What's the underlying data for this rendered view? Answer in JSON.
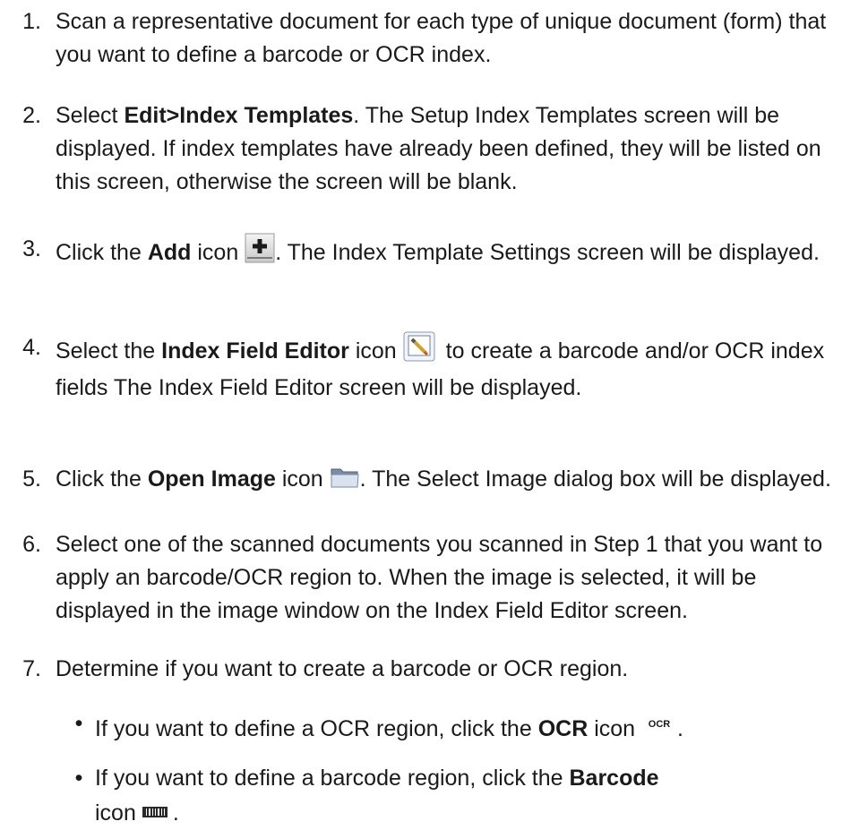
{
  "steps": [
    {
      "num": "1.",
      "text": "Scan a representative document for each type of unique document (form) that you want to define a barcode or OCR index."
    },
    {
      "num": "2.",
      "pre": "Select ",
      "bold": "Edit>Index Templates",
      "post": ". The Setup Index Templates screen will be displayed. If index templates have already been defined, they will be listed on this screen, otherwise the screen will be blank."
    },
    {
      "num": "3.",
      "pre": "Click the ",
      "bold": "Add",
      "mid": " icon ",
      "icon": "add-icon",
      "post": ". The Index Template Settings screen will be displayed."
    },
    {
      "num": "4.",
      "pre": "Select the ",
      "bold": "Index Field Editor",
      "mid": " icon ",
      "icon": "index-field-editor-icon",
      "post": "to create a barcode and/or OCR index fields The Index Field Editor screen will be displayed."
    },
    {
      "num": "5.",
      "pre": "Click the ",
      "bold": "Open Image",
      "mid": " icon ",
      "icon": "open-folder-icon",
      "post": ". The Select Image dialog box will be displayed."
    },
    {
      "num": "6.",
      "text": "Select one of the scanned documents you scanned in Step 1 that you want to apply an barcode/OCR region to. When the image is selected, it will be displayed in the image window on the Index Field Editor screen."
    },
    {
      "num": "7.",
      "text": "Determine if you want to create a barcode or OCR region."
    }
  ],
  "bullets": [
    {
      "dot": "•",
      "pre": "If you want to define a OCR region, click the ",
      "bold": "OCR",
      "mid": " icon ",
      "icon_text": "OCR",
      "post": "."
    },
    {
      "dot": "•",
      "pre": "If you want to define a barcode region, click the ",
      "bold": "Barcode",
      "line2_pre": "icon ",
      "icon": "barcode-icon",
      "post": "."
    }
  ]
}
